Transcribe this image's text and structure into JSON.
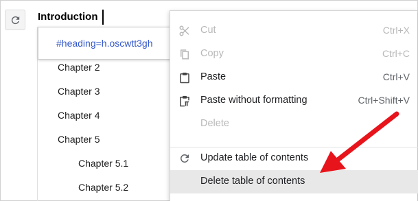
{
  "document": {
    "heading": "Introduction",
    "link_popup_text": "#heading=h.oscwtt3gh",
    "toc_lines": [
      {
        "text": "Chapter 2"
      },
      {
        "text": "Chapter 3"
      },
      {
        "text": "Chapter 4"
      },
      {
        "text": "Chapter 5"
      },
      {
        "text": "Chapter 5.1"
      },
      {
        "text": "Chapter 5.2"
      }
    ]
  },
  "context_menu": {
    "items": [
      {
        "label": "Cut",
        "shortcut": "Ctrl+X",
        "icon": "scissors-icon",
        "disabled": true
      },
      {
        "label": "Copy",
        "shortcut": "Ctrl+C",
        "icon": "copy-icon",
        "disabled": true
      },
      {
        "label": "Paste",
        "shortcut": "Ctrl+V",
        "icon": "paste-icon",
        "disabled": false
      },
      {
        "label": "Paste without formatting",
        "shortcut": "Ctrl+Shift+V",
        "icon": "paste-plain-icon",
        "disabled": false
      },
      {
        "label": "Delete",
        "shortcut": "",
        "icon": "",
        "disabled": true
      },
      {
        "label": "Update table of contents",
        "shortcut": "",
        "icon": "refresh-icon",
        "disabled": false
      },
      {
        "label": "Delete table of contents",
        "shortcut": "",
        "icon": "",
        "disabled": false,
        "highlighted": true
      }
    ]
  },
  "colors": {
    "link": "#3457c9",
    "highlight": "#e8e8e8",
    "arrow": "#e8141b"
  }
}
